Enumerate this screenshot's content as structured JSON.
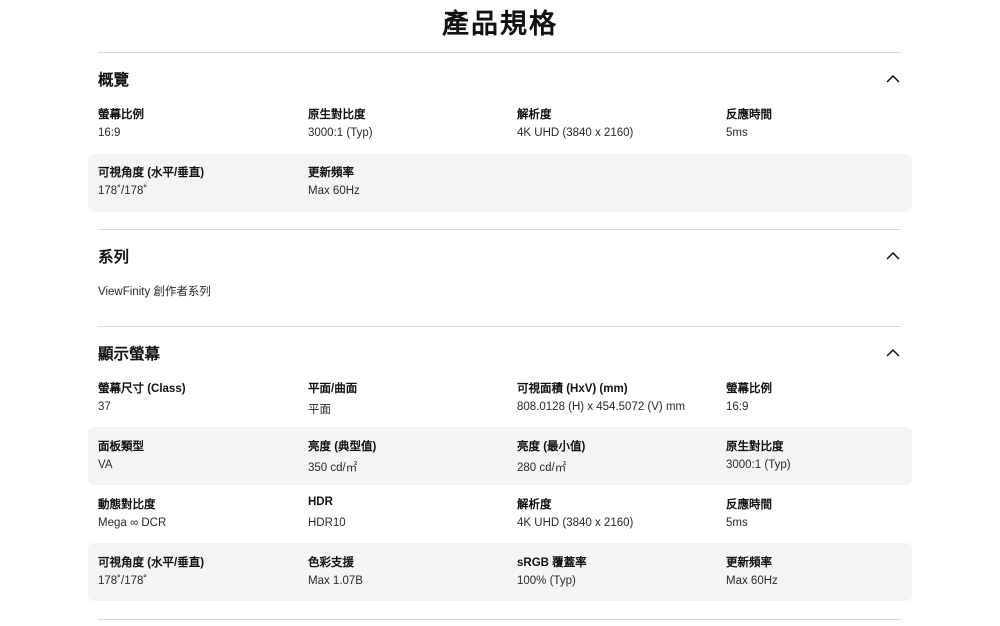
{
  "page": {
    "title": "產品規格"
  },
  "sections": [
    {
      "title": "概覽",
      "rows": [
        [
          {
            "label": "螢幕比例",
            "value": "16:9"
          },
          {
            "label": "原生對比度",
            "value": "3000:1 (Typ)"
          },
          {
            "label": "解析度",
            "value": "4K UHD (3840 x 2160)"
          },
          {
            "label": "反應時間",
            "value": "5ms"
          }
        ],
        [
          {
            "label": "可視角度 (水平/垂直)",
            "value": "178˚/178˚"
          },
          {
            "label": "更新頻率",
            "value": "Max 60Hz"
          }
        ]
      ]
    },
    {
      "title": "系列",
      "value": "ViewFinity 創作者系列"
    },
    {
      "title": "顯示螢幕",
      "rows": [
        [
          {
            "label": "螢幕尺寸 (Class)",
            "value": "37"
          },
          {
            "label": "平面/曲面",
            "value": "平面"
          },
          {
            "label": "可視面積 (HxV) (mm)",
            "value": "808.0128 (H) x 454.5072 (V) mm"
          },
          {
            "label": "螢幕比例",
            "value": "16:9"
          }
        ],
        [
          {
            "label": "面板類型",
            "value": "VA"
          },
          {
            "label": "亮度 (典型值)",
            "value": "350 cd/㎡"
          },
          {
            "label": "亮度 (最小值)",
            "value": "280 cd/㎡"
          },
          {
            "label": "原生對比度",
            "value": "3000:1 (Typ)"
          }
        ],
        [
          {
            "label": "動態對比度",
            "value": "Mega ∞ DCR"
          },
          {
            "label": "HDR",
            "value": "HDR10"
          },
          {
            "label": "解析度",
            "value": "4K UHD (3840 x 2160)"
          },
          {
            "label": "反應時間",
            "value": "5ms"
          }
        ],
        [
          {
            "label": "可視角度 (水平/垂直)",
            "value": "178˚/178˚"
          },
          {
            "label": "色彩支援",
            "value": "Max 1.07B"
          },
          {
            "label": "sRGB 覆蓋率",
            "value": "100% (Typ)"
          },
          {
            "label": "更新頻率",
            "value": "Max 60Hz"
          }
        ]
      ]
    }
  ],
  "icons": {
    "collapse": "chevron-up-icon"
  }
}
